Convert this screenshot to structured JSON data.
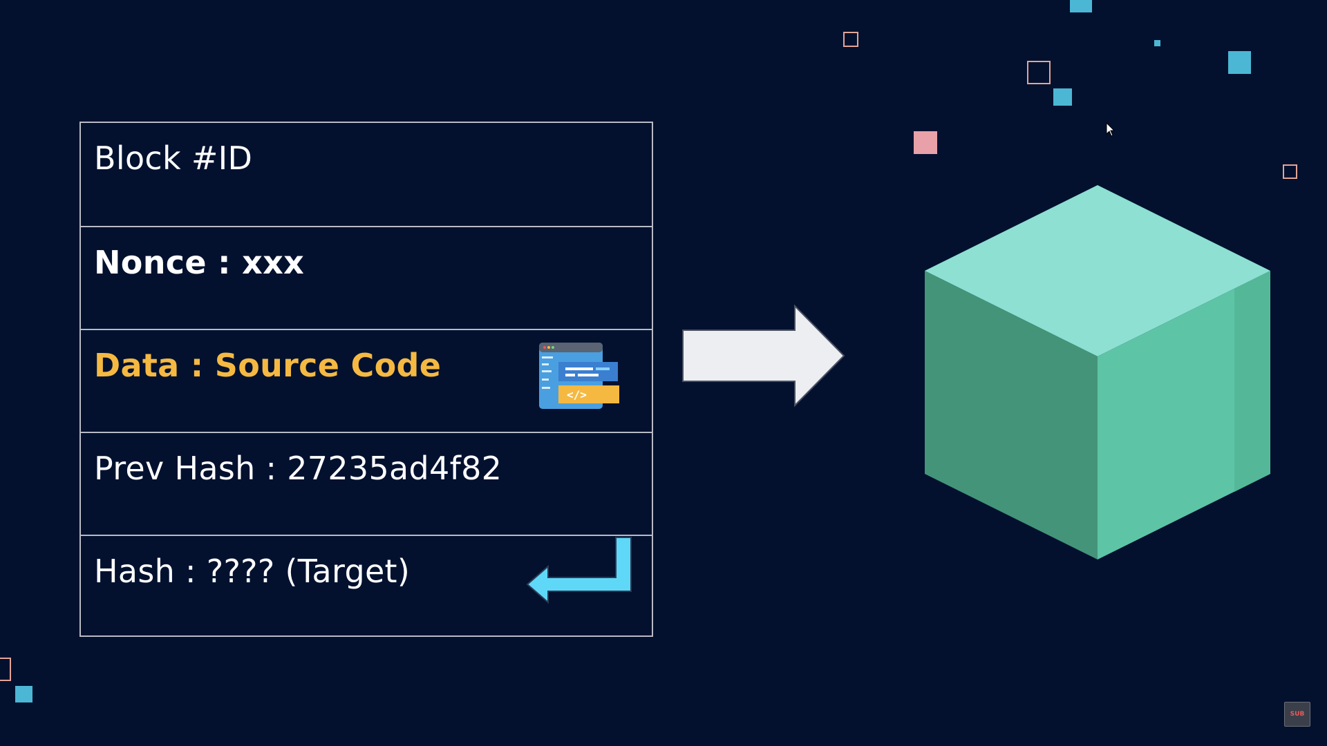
{
  "block": {
    "rows": [
      {
        "label": "Block #ID"
      },
      {
        "label": "Nonce : xxx"
      },
      {
        "label": "Data : Source Code"
      },
      {
        "label": "Prev Hash : 27235ad4f82"
      },
      {
        "label": "Hash : ???? (Target)"
      }
    ]
  },
  "icons": {
    "code": "source-code-window-icon",
    "return_arrow": "return-arrow-icon",
    "big_arrow": "right-arrow-icon",
    "cube": "block-cube-icon",
    "badge": "subscribe-badge-icon"
  },
  "badge": {
    "label": "SUB"
  },
  "colors": {
    "background": "#03112f",
    "accent_text": "#f5b942",
    "cube_top": "#8de0d2",
    "cube_left": "#449479",
    "cube_right": "#5ec4a6",
    "return_arrow": "#5fd8f7",
    "big_arrow": "#eceef2"
  }
}
